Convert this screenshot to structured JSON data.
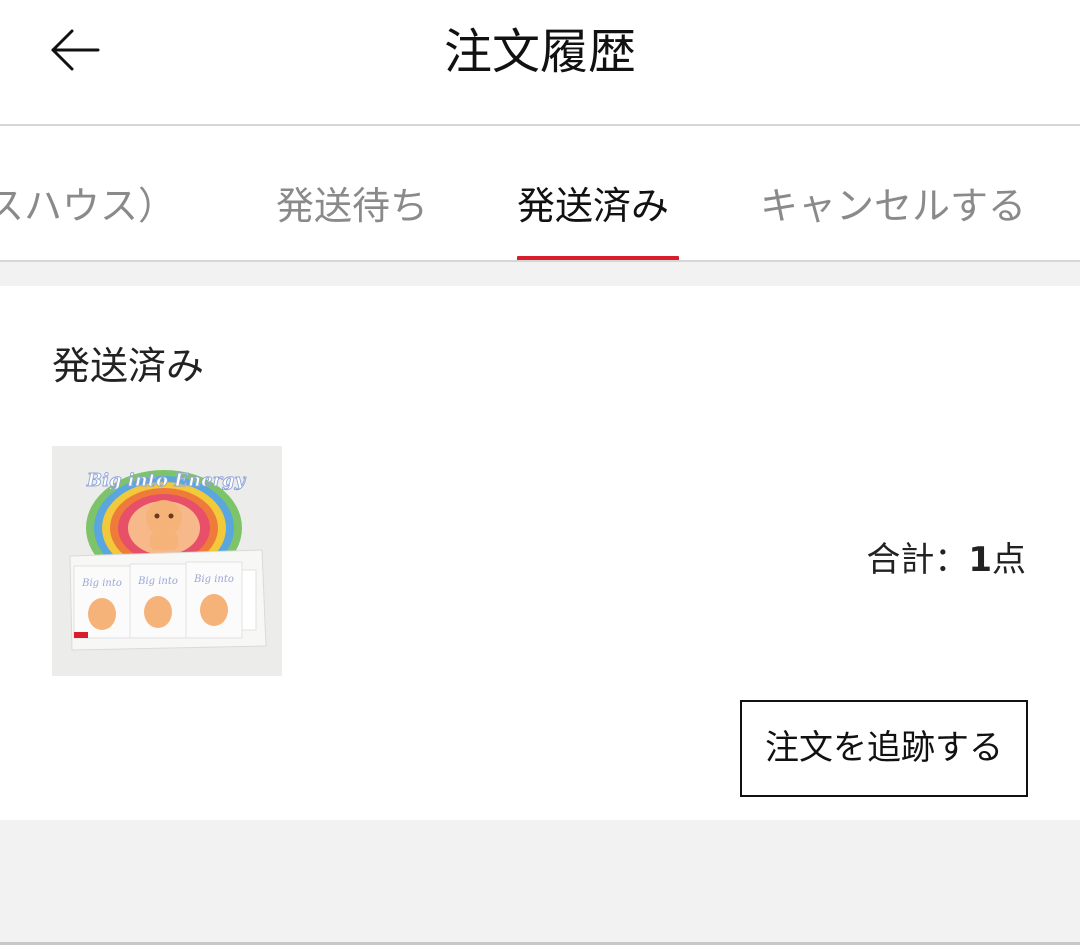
{
  "header": {
    "title": "注文履歴",
    "back_icon": "arrow-left-icon"
  },
  "tabs": [
    {
      "label": "スハウス）",
      "active": false
    },
    {
      "label": "発送待ち",
      "active": false
    },
    {
      "label": "発送済み",
      "active": true
    },
    {
      "label": "キャンセルする",
      "active": false
    }
  ],
  "order": {
    "status": "発送済み",
    "product_image_text": "Big into Energy",
    "total_prefix": "合計：",
    "total_count": "1",
    "total_unit": "点",
    "track_button_label": "注文を追跡する"
  },
  "colors": {
    "accent": "#d81e2a",
    "page_gray": "#f2f2f2",
    "inactive_tab_text": "#8a8a8a"
  }
}
